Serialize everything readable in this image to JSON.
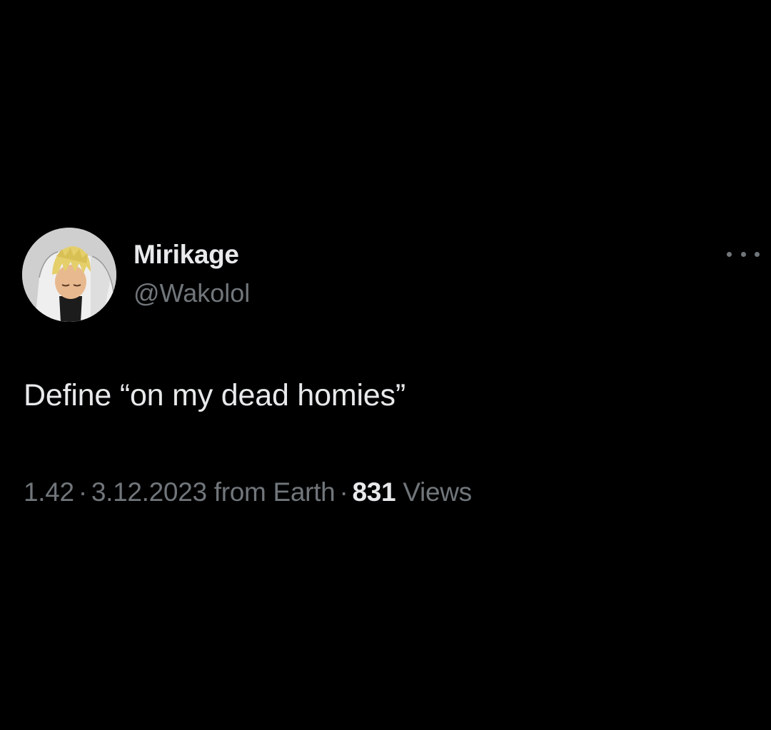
{
  "tweet": {
    "author": {
      "display_name": "Mirikage",
      "handle": "@Wakolol",
      "avatar_icon": "anime-character-avatar"
    },
    "more_icon": "more-horizontal-icon",
    "text": "Define “on my dead homies”",
    "meta": {
      "time": "1.42",
      "separator": "·",
      "date": "3.12.2023 from Earth",
      "views_count": "831",
      "views_label": "Views"
    }
  },
  "colors": {
    "background": "#000000",
    "primary_text": "#e7e9ea",
    "secondary_text": "#71767b"
  }
}
